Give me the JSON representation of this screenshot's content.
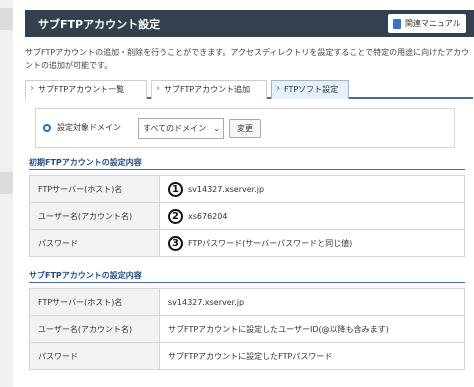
{
  "header": {
    "title": "サブFTPアカウント設定",
    "manual_label": "関連マニュアル"
  },
  "description": "サブFTPアカウントの追加・削除を行うことができます。アクセスディレクトリを設定することで特定の用途に向けたアカウントの追加が可能です。",
  "tabs": [
    {
      "label": "サブFTPアカウント一覧"
    },
    {
      "label": "サブFTPアカウント追加"
    },
    {
      "label": "FTPソフト設定"
    }
  ],
  "domain_select": {
    "label": "設定対象ドメイン",
    "value": "すべてのドメイン",
    "button": "変更"
  },
  "initial_section": {
    "title": "初期FTPアカウントの設定内容",
    "rows": [
      {
        "key": "FTPサーバー(ホスト)名",
        "marker": "1",
        "value": "sv14327.xserver.jp"
      },
      {
        "key": "ユーザー名(アカウント名)",
        "marker": "2",
        "value": "xs676204"
      },
      {
        "key": "パスワード",
        "marker": "3",
        "value": "FTPパスワード(サーバーパスワードと同じ値)"
      }
    ]
  },
  "sub_section": {
    "title": "サブFTPアカウントの設定内容",
    "rows": [
      {
        "key": "FTPサーバー(ホスト)名",
        "value": "sv14327.xserver.jp"
      },
      {
        "key": "ユーザー名(アカウント名)",
        "value": "サブFTPアカウントに設定したユーザーID(@以降も含みます)"
      },
      {
        "key": "パスワード",
        "value": "サブFTPアカウントに設定したFTPパスワード"
      }
    ]
  },
  "colors": {
    "header_bg": "#33414f",
    "accent": "#4a6d94",
    "section_title": "#234d82"
  }
}
